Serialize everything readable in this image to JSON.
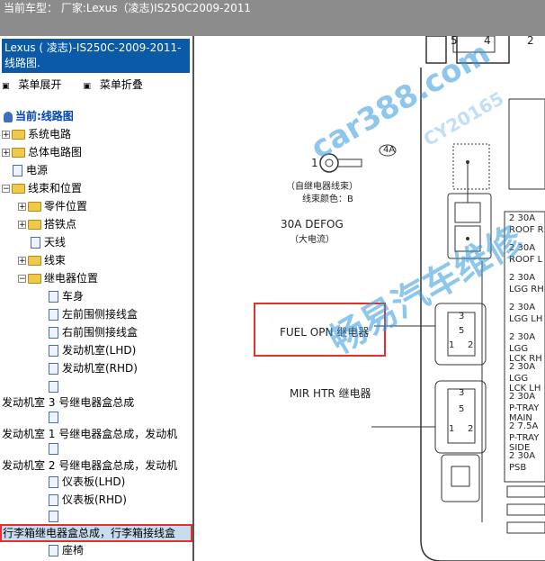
{
  "window": {
    "title": "当前车型：  厂家:Lexus（凌志)IS250C2009-2011"
  },
  "panel": {
    "header": "Lexus ( 凌志)-IS250C-2009-2011- 线路图.",
    "menu": {
      "expand": "菜单展开",
      "collapse": "菜单折叠"
    },
    "current_label": "当前:线路图",
    "tree": [
      {
        "label": "系统电路"
      },
      {
        "label": "总体电路图"
      },
      {
        "label": "电源"
      },
      {
        "label": "线束和位置"
      },
      {
        "label": "零件位置"
      },
      {
        "label": "搭铁点"
      },
      {
        "label": "天线"
      },
      {
        "label": "线束"
      },
      {
        "label": "继电器位置"
      },
      {
        "label": "车身"
      },
      {
        "label": "左前围侧接线盒"
      },
      {
        "label": "右前围侧接线盒"
      },
      {
        "label": "发动机室(LHD)"
      },
      {
        "label": "发动机室(RHD)"
      },
      {
        "label": "发动机室 3 号继电器盒总成"
      },
      {
        "label": "发动机室 1 号继电器盒总成，发动机"
      },
      {
        "label": "发动机室 2 号继电器盒总成，发动机"
      },
      {
        "label": "仪表板(LHD)"
      },
      {
        "label": "仪表板(RHD)"
      },
      {
        "label": "行李箱继电器盒总成，行李箱接线盒"
      },
      {
        "label": "座椅"
      }
    ]
  },
  "diagram": {
    "terminal_num": "1",
    "terminal_tag": "4A",
    "terminal_note1": "（自继电器线束）",
    "terminal_note2": "线束颜色：B",
    "defog_label": "30A DEFOG",
    "defog_note": "（大电流）",
    "fuel_opn": "FUEL OPN 继电器",
    "mir_htr": "MIR HTR 继电器",
    "relay_pins_a": [
      "3",
      "5",
      "1",
      "2"
    ],
    "relay_pins_b": [
      "3",
      "5",
      "1",
      "2"
    ],
    "top_pins": [
      "5",
      "4",
      "2"
    ],
    "fuses": [
      {
        "pos": "2",
        "amp": "30A",
        "name": "ROOF R"
      },
      {
        "pos": "2",
        "amp": "30A",
        "name": "ROOF L"
      },
      {
        "pos": "2",
        "amp": "30A",
        "name": "LGG RH"
      },
      {
        "pos": "2",
        "amp": "30A",
        "name": "LGG LH"
      },
      {
        "pos": "2",
        "amp": "30A",
        "name": "LGG LCK RH"
      },
      {
        "pos": "2",
        "amp": "30A",
        "name": "LGG LCK LH"
      },
      {
        "pos": "2",
        "amp": "30A",
        "name": "P-TRAY MAIN"
      },
      {
        "pos": "2",
        "amp": "7.5A",
        "name": "P-TRAY SIDE"
      },
      {
        "pos": "2",
        "amp": "30A",
        "name": "PSB"
      }
    ],
    "watermarks": [
      "畅易汽车维修",
      "car388.com",
      "CY20165"
    ],
    "colors": {
      "accent": "#0b5aa8",
      "highlight": "#e03030",
      "watermark": "#3399dd"
    }
  }
}
